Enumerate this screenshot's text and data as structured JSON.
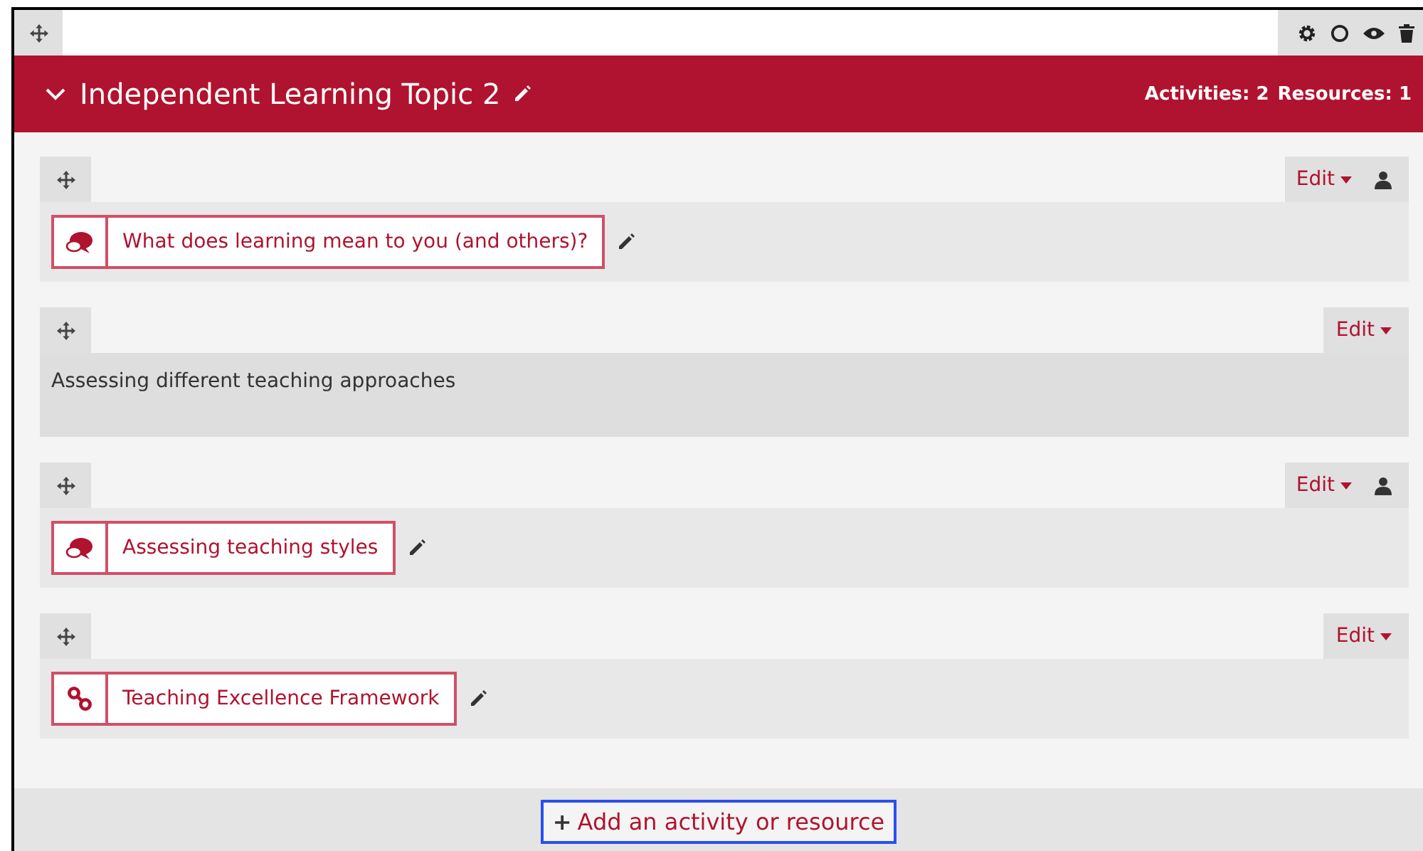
{
  "section": {
    "title": "Independent Learning Topic 2",
    "summary": [
      {
        "text": "Activities: 2"
      },
      {
        "text": "Resources: 1"
      }
    ]
  },
  "modules": [
    {
      "kind": "forum",
      "name": "What does learning mean to you (and others)?",
      "edit": "Edit",
      "group_mode": true
    },
    {
      "kind": "label",
      "name": "Assessing different teaching approaches",
      "edit": "Edit",
      "group_mode": false
    },
    {
      "kind": "forum",
      "name": "Assessing teaching styles",
      "edit": "Edit",
      "group_mode": true
    },
    {
      "kind": "url",
      "name": "Teaching Excellence Framework",
      "edit": "Edit",
      "group_mode": false
    }
  ],
  "add_button": {
    "icon": "+",
    "label": "Add an activity or resource"
  }
}
